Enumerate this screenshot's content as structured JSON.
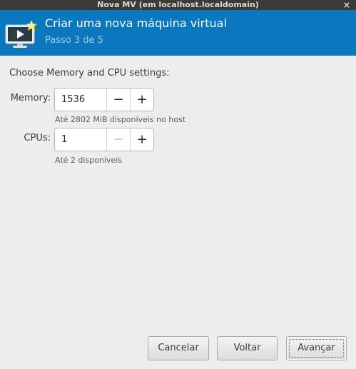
{
  "window": {
    "title": "Nova MV (em localhost.localdomain)",
    "close_glyph": "×"
  },
  "header": {
    "title": "Criar uma nova máquina virtual",
    "subtitle": "Passo 3 de 5",
    "icon": "monitor-play-star-icon"
  },
  "main": {
    "section_label": "Choose Memory and CPU settings:",
    "memory": {
      "label": "Memory:",
      "value": "1536",
      "hint": "Até 2802 MiB disponíveis no host",
      "decrement": "−",
      "increment": "+"
    },
    "cpus": {
      "label": "CPUs:",
      "value": "1",
      "hint": "Até 2 disponíveis",
      "decrement": "−",
      "increment": "+"
    }
  },
  "footer": {
    "cancel_label": "Cancelar",
    "back_label": "Voltar",
    "forward_label": "Avançar"
  },
  "colors": {
    "header_bg": "#0b77bd",
    "titlebar_bg": "#3c3b37",
    "window_bg": "#ededed"
  }
}
